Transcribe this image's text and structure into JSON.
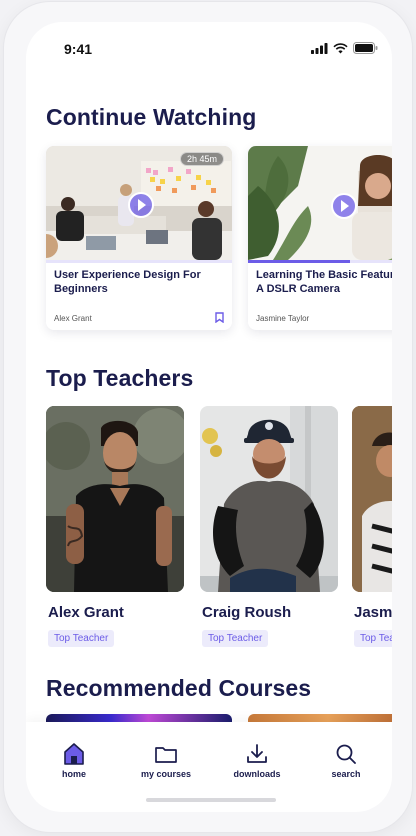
{
  "status_bar": {
    "time": "9:41"
  },
  "sections": {
    "continue_watching": "Continue Watching",
    "top_teachers": "Top Teachers",
    "recommended": "Recommended Courses"
  },
  "continue_watching": [
    {
      "title": "User Experience Design For Beginners",
      "author": "Alex Grant",
      "duration": "2h 45m",
      "progress": 0.0
    },
    {
      "title": "Learning The Basic Features of A DSLR Camera",
      "author": "Jasmine Taylor",
      "progress": 0.55
    }
  ],
  "teachers": [
    {
      "name": "Alex Grant",
      "badge": "Top Teacher"
    },
    {
      "name": "Craig Roush",
      "badge": "Top Teacher"
    },
    {
      "name": "Jasmine",
      "badge": "Top Teacher"
    }
  ],
  "tabbar": {
    "items": [
      {
        "label": "home",
        "icon": "home-icon",
        "active": true
      },
      {
        "label": "my courses",
        "icon": "folder-icon"
      },
      {
        "label": "downloads",
        "icon": "download-icon"
      },
      {
        "label": "search",
        "icon": "search-icon"
      }
    ]
  },
  "colors": {
    "accent": "#6c5ce7",
    "title": "#1b1d4d",
    "badge_bg": "#ecebfb"
  }
}
